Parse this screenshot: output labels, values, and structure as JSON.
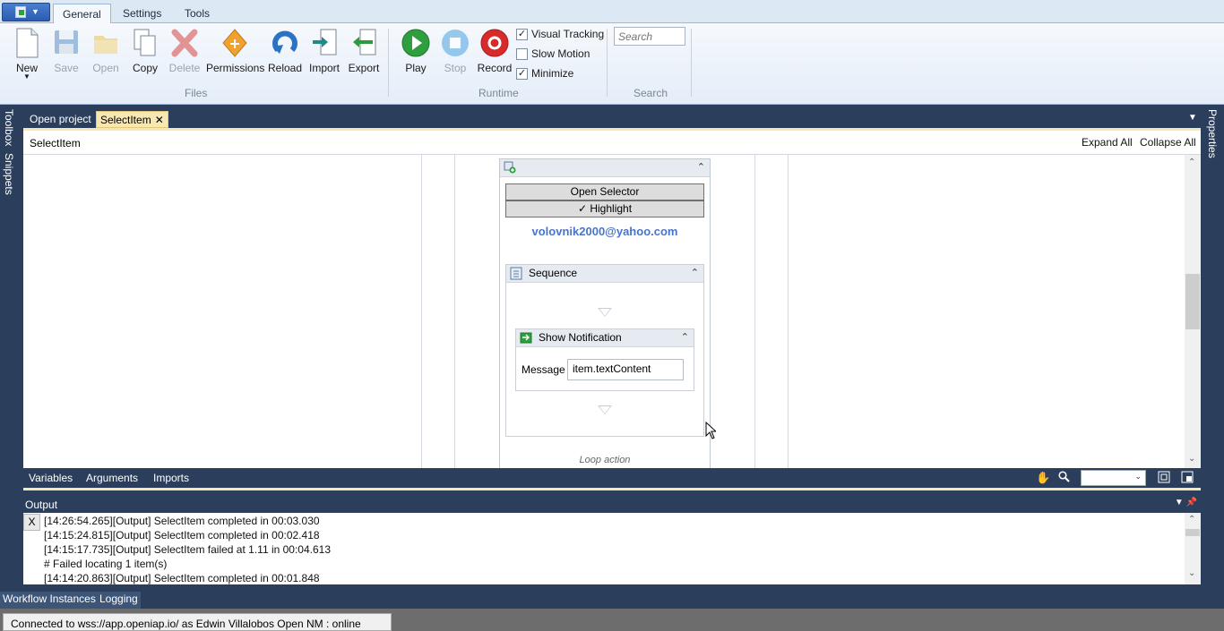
{
  "ribbon": {
    "tabs": [
      "General",
      "Settings",
      "Tools"
    ],
    "active_tab": "General",
    "files_group": {
      "label": "Files",
      "buttons": [
        {
          "label": "New",
          "icon": "new-document-icon",
          "enabled": true
        },
        {
          "label": "Save",
          "icon": "save-disk-icon",
          "enabled": false
        },
        {
          "label": "Open",
          "icon": "folder-icon",
          "enabled": false
        },
        {
          "label": "Copy",
          "icon": "copy-icon",
          "enabled": true
        },
        {
          "label": "Delete",
          "icon": "delete-x-icon",
          "enabled": false
        },
        {
          "label": "Permissions",
          "icon": "permissions-icon",
          "enabled": true
        },
        {
          "label": "Reload",
          "icon": "reload-icon",
          "enabled": true
        },
        {
          "label": "Import",
          "icon": "import-icon",
          "enabled": true
        },
        {
          "label": "Export",
          "icon": "export-icon",
          "enabled": true
        }
      ]
    },
    "runtime_group": {
      "label": "Runtime",
      "buttons": [
        {
          "label": "Play",
          "icon": "play-icon",
          "enabled": true
        },
        {
          "label": "Stop",
          "icon": "stop-icon",
          "enabled": false
        },
        {
          "label": "Record",
          "icon": "record-icon",
          "enabled": true
        }
      ],
      "checkboxes": [
        {
          "label": "Visual Tracking",
          "checked": true
        },
        {
          "label": "Slow Motion",
          "checked": false
        },
        {
          "label": "Minimize",
          "checked": true
        }
      ]
    },
    "search_group": {
      "label": "Search",
      "placeholder": "Search"
    }
  },
  "side_panels": {
    "left": [
      "Toolbox",
      "Snippets"
    ],
    "right": [
      "Properties"
    ]
  },
  "document_tabs": {
    "inactive": "Open project",
    "active": "SelectItem",
    "close_glyph": "✕"
  },
  "designer": {
    "breadcrumb": "SelectItem",
    "expand_all": "Expand All",
    "collapse_all": "Collapse All",
    "select_activity": {
      "open_selector": "Open Selector",
      "highlight": "✓ Highlight",
      "selector_value": "volovnik2000@yahoo.com"
    },
    "sequence": {
      "title": "Sequence"
    },
    "show_notification": {
      "title": "Show Notification",
      "message_label": "Message",
      "message_value": "item.textContent"
    },
    "loop_caption": "Loop action"
  },
  "designer_bar": {
    "tabs": [
      "Variables",
      "Arguments",
      "Imports"
    ],
    "zoom_value": ""
  },
  "output": {
    "title": "Output",
    "clear_label": "X",
    "lines": [
      "[14:26:54.265][Output] SelectItem completed in 00:03.030",
      "[14:15:24.815][Output] SelectItem completed in 00:02.418",
      "[14:15:17.735][Output] SelectItem failed at 1.11 in 00:04.613",
      "# Failed locating 1 item(s)",
      "[14:14:20.863][Output] SelectItem completed in 00:01.848"
    ]
  },
  "bottom_tabs": [
    "Workflow Instances",
    "Logging"
  ],
  "status": {
    "text": "Connected to wss://app.openiap.io/ as Edwin Villalobos  Open       NM : online"
  },
  "colors": {
    "dark_chrome": "#2b3f5c",
    "tab_highlight": "#f6e7b3",
    "selector_link": "#4a74c9"
  }
}
